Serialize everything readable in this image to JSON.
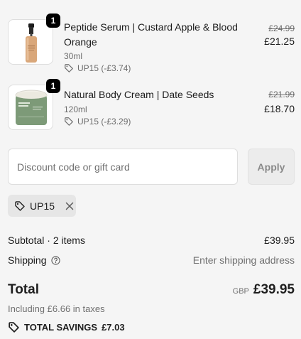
{
  "items": [
    {
      "quantity": "1",
      "name_line1": "Peptide Serum | Custard Apple & Blood",
      "name_line2": "Orange",
      "variant": "30ml",
      "discount": "UP15 (-£3.74)",
      "original_price": "£24.99",
      "price": "£21.25",
      "image": "serum-bottle-image"
    },
    {
      "quantity": "1",
      "name_line1": "Natural Body Cream | Date Seeds",
      "variant": "120ml",
      "discount": "UP15 (-£3.29)",
      "original_price": "£21.99",
      "price": "£18.70",
      "image": "body-cream-jar-image"
    }
  ],
  "discount_form": {
    "placeholder": "Discount code or gift card",
    "apply_label": "Apply"
  },
  "applied_code": {
    "code": "UP15",
    "icon": "tag-icon",
    "remove_icon": "close-icon"
  },
  "summary": {
    "subtotal_label": "Subtotal · 2 items",
    "subtotal_value": "£39.95",
    "shipping_label": "Shipping",
    "shipping_value": "Enter shipping address",
    "total_label": "Total",
    "currency": "GBP",
    "total_value": "£39.95",
    "taxes_note": "Including £6.66 in taxes",
    "savings_label": "TOTAL SAVINGS",
    "savings_value": "£7.03"
  },
  "colors": {
    "background": "#f5f5f5",
    "badge": "#000000",
    "muted_text": "#707070"
  }
}
